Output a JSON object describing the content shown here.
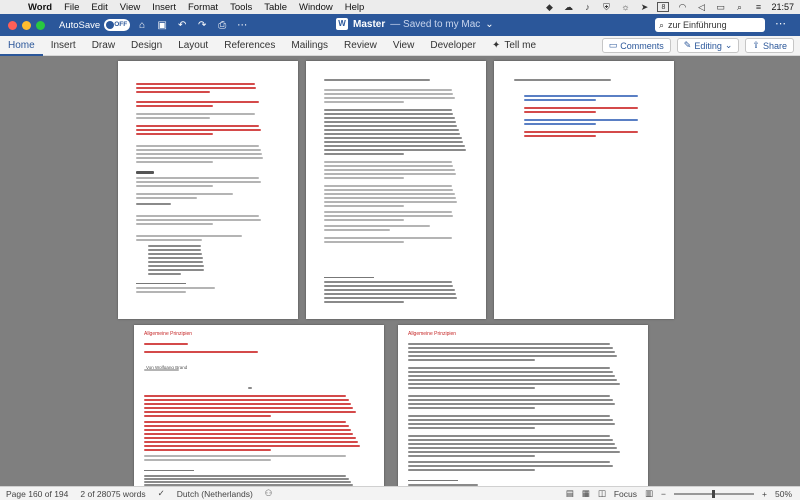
{
  "menubar": {
    "app": "Word",
    "items": [
      "File",
      "Edit",
      "View",
      "Insert",
      "Format",
      "Tools",
      "Table",
      "Window",
      "Help"
    ],
    "clock": "21:57",
    "date_badge": "8"
  },
  "titlebar": {
    "autosave_label": "AutoSave",
    "autosave_state": "OFF",
    "doc_name": "Master",
    "doc_status": "— Saved to my Mac",
    "search_value": "zur Einführung"
  },
  "ribbon": {
    "tabs": [
      "Home",
      "Insert",
      "Draw",
      "Design",
      "Layout",
      "References",
      "Mailings",
      "Review",
      "View",
      "Developer"
    ],
    "tell_me": "Tell me",
    "comments": "Comments",
    "editing": "Editing",
    "share": "Share"
  },
  "pages": {
    "bottom_left_header": "Allgemeine Prinzipien",
    "bottom_right_header": "Allgemeine Prinzipien",
    "author": "Von Wolfgang Brand"
  },
  "statusbar": {
    "page": "Page 160 of 194",
    "words": "2 of 28075 words",
    "language": "Dutch (Netherlands)",
    "focus": "Focus",
    "zoom": "50%"
  },
  "colors": {
    "word_blue": "#2b579a",
    "track_change_red": "#d44a4a"
  }
}
